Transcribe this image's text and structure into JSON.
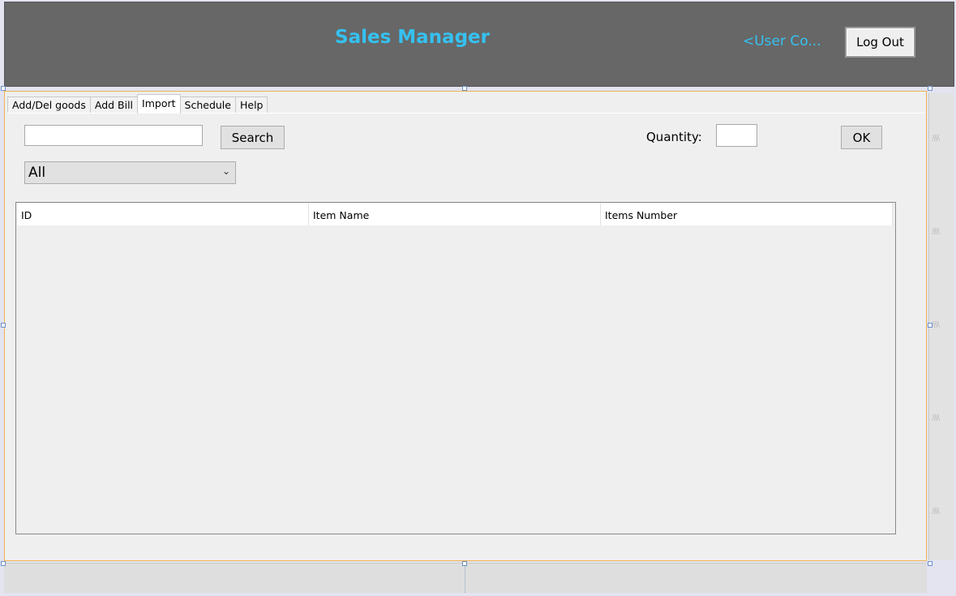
{
  "header": {
    "title": "Sales Manager",
    "user_link": "<User Co...",
    "logout_label": "Log Out"
  },
  "tabs": [
    {
      "label": "Add/Del goods"
    },
    {
      "label": "Add Bill"
    },
    {
      "label": "Import",
      "active": true
    },
    {
      "label": "Schedule"
    },
    {
      "label": "Help"
    }
  ],
  "import_form": {
    "search_value": "",
    "search_button": "Search",
    "quantity_label": "Quantity:",
    "quantity_value": "",
    "ok_button": "OK",
    "filter_selected": "All",
    "chevron_icon": "chevron-down-icon"
  },
  "table": {
    "columns": [
      "ID",
      "Item Name",
      "Items Number"
    ],
    "rows": []
  },
  "colors": {
    "header_bg": "#676767",
    "accent": "#35c1f0",
    "form_border": "#f0b24e"
  }
}
